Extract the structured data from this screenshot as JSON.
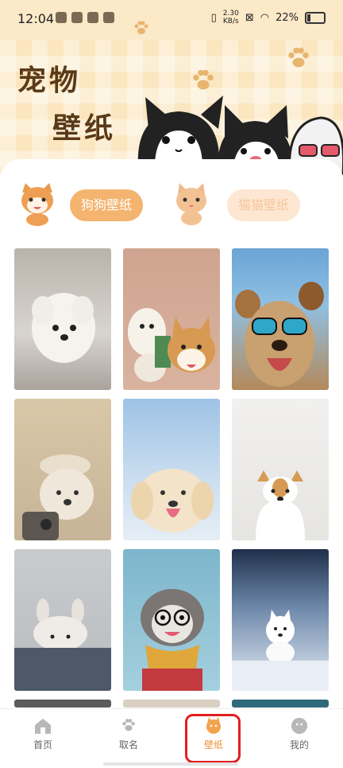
{
  "status_bar": {
    "time": "12:04",
    "network_speed": "2.30\nKB/s",
    "battery": "22%"
  },
  "hero": {
    "title_line1": "宠物",
    "title_line2": "壁纸"
  },
  "tabs": {
    "dog_label": "狗狗壁纸",
    "cat_label": "猫猫壁纸",
    "active": "dog"
  },
  "wallpapers": [
    {
      "name": "white-fluffy-dog"
    },
    {
      "name": "plush-toy-and-shiba"
    },
    {
      "name": "dogs-with-sunglasses"
    },
    {
      "name": "dog-with-hat-selfie"
    },
    {
      "name": "golden-retriever-sky"
    },
    {
      "name": "ghost-dog"
    },
    {
      "name": "dog-with-bunny-hat"
    },
    {
      "name": "dog-glasses-scarf"
    },
    {
      "name": "samoyed-snow"
    }
  ],
  "bottom_nav": [
    {
      "label": "首页",
      "icon": "home-icon"
    },
    {
      "label": "取名",
      "icon": "paw-icon"
    },
    {
      "label": "壁纸",
      "icon": "dog-icon",
      "active": true
    },
    {
      "label": "我的",
      "icon": "profile-icon"
    }
  ],
  "colors": {
    "accent": "#f4b46f",
    "hero_bg": "#fbe6c0",
    "highlight": "#e21f1f"
  }
}
